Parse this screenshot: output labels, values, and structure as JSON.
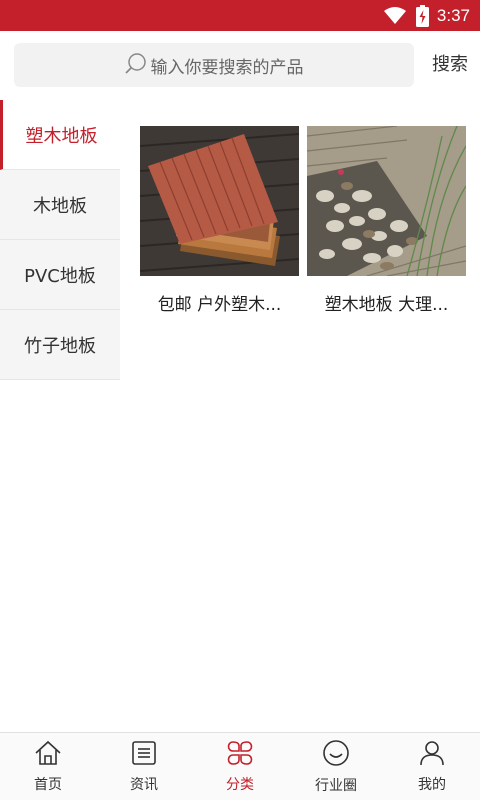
{
  "status_bar": {
    "time": "3:37",
    "icons": [
      "wifi-icon",
      "battery-charging-icon"
    ]
  },
  "search": {
    "placeholder": "输入你要搜索的产品",
    "button_label": "搜索",
    "icon": "search-icon"
  },
  "sidebar": {
    "items": [
      {
        "label": "塑木地板",
        "active": true
      },
      {
        "label": "木地板",
        "active": false
      },
      {
        "label": "PVC地板",
        "active": false
      },
      {
        "label": "竹子地板",
        "active": false
      }
    ]
  },
  "products": [
    {
      "title": "包邮 户外塑木...",
      "image": "wpc-deck-tiles-photo"
    },
    {
      "title": "塑木地板 大理...",
      "image": "deck-tiles-pebbles-photo"
    }
  ],
  "tabbar": {
    "items": [
      {
        "label": "首页",
        "icon": "home-icon",
        "active": false
      },
      {
        "label": "资讯",
        "icon": "news-icon",
        "active": false
      },
      {
        "label": "分类",
        "icon": "category-icon",
        "active": true
      },
      {
        "label": "行业圈",
        "icon": "community-icon",
        "active": false
      },
      {
        "label": "我的",
        "icon": "profile-icon",
        "active": false
      }
    ]
  },
  "colors": {
    "accent": "#c4202c",
    "sidebar_bg": "#f5f5f5",
    "search_bg": "#f2f2f2"
  }
}
